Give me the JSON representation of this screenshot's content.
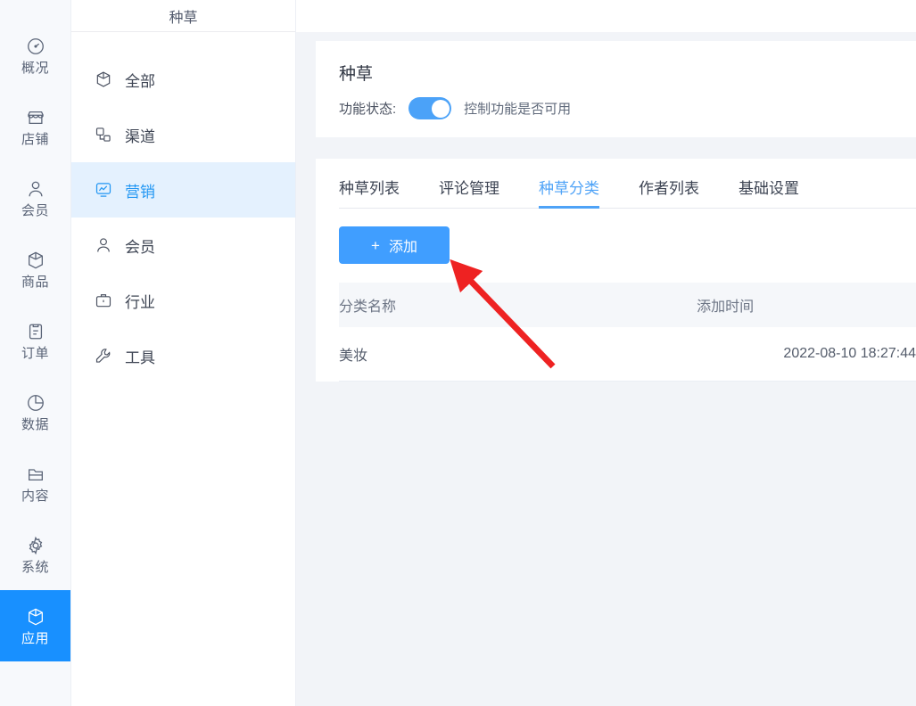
{
  "rail": {
    "items": [
      {
        "label": "概况",
        "icon": "dashboard-icon",
        "active": false
      },
      {
        "label": "店铺",
        "icon": "shop-icon",
        "active": false
      },
      {
        "label": "会员",
        "icon": "user-icon",
        "active": false
      },
      {
        "label": "商品",
        "icon": "box-icon",
        "active": false
      },
      {
        "label": "订单",
        "icon": "clipboard-icon",
        "active": false
      },
      {
        "label": "数据",
        "icon": "pie-chart-icon",
        "active": false
      },
      {
        "label": "内容",
        "icon": "folder-icon",
        "active": false
      },
      {
        "label": "系统",
        "icon": "gear-icon",
        "active": false
      },
      {
        "label": "应用",
        "icon": "cube-icon",
        "active": true
      }
    ]
  },
  "menu": {
    "title": "种草",
    "items": [
      {
        "label": "全部",
        "icon": "cube-icon",
        "active": false
      },
      {
        "label": "渠道",
        "icon": "channel-icon",
        "active": false
      },
      {
        "label": "营销",
        "icon": "marketing-chart-icon",
        "active": true
      },
      {
        "label": "会员",
        "icon": "user-icon",
        "active": false
      },
      {
        "label": "行业",
        "icon": "briefcase-icon",
        "active": false
      },
      {
        "label": "工具",
        "icon": "wrench-icon",
        "active": false
      }
    ]
  },
  "page": {
    "title": "种草",
    "state_label": "功能状态:",
    "state_hint": "控制功能是否可用",
    "switch_on": true
  },
  "tabs": [
    {
      "label": "种草列表",
      "active": false
    },
    {
      "label": "评论管理",
      "active": false
    },
    {
      "label": "种草分类",
      "active": true
    },
    {
      "label": "作者列表",
      "active": false
    },
    {
      "label": "基础设置",
      "active": false
    }
  ],
  "toolbar": {
    "add_label": "添加",
    "add_plus": "+"
  },
  "table": {
    "columns": [
      "分类名称",
      "添加时间"
    ],
    "rows": [
      {
        "name": "美妆",
        "time": "2022-08-10 18:27:44"
      }
    ]
  },
  "colors": {
    "accent": "#409eff",
    "rail_active": "#1890ff",
    "menu_active_bg": "#e4f1fe",
    "menu_active_text": "#2196f3",
    "tab_active": "#4fa3f7",
    "annotation_arrow": "#ee2222",
    "page_bg": "#f2f4f8",
    "table_header_bg": "#f5f7fa"
  },
  "annotation": {
    "type": "arrow",
    "points_to": "add-button"
  }
}
